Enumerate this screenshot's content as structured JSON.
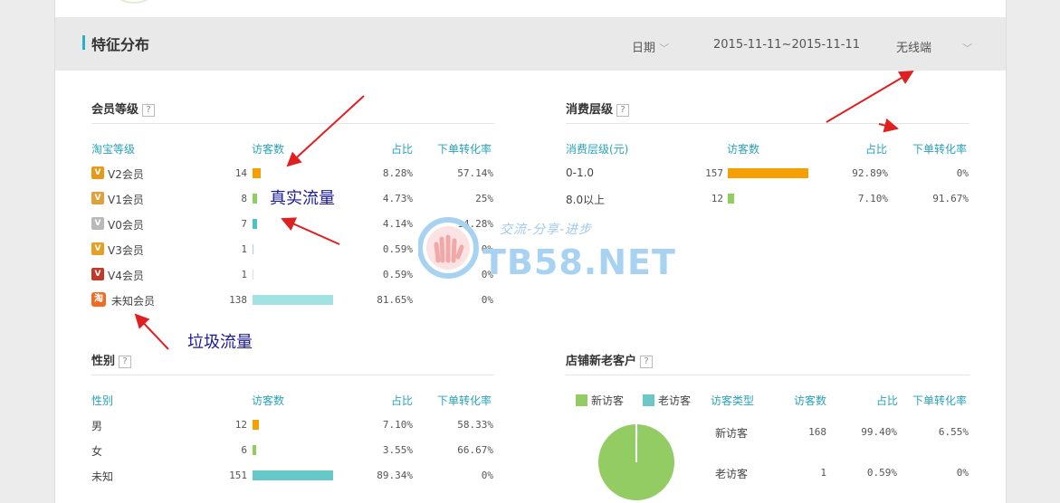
{
  "header": {
    "title": "特征分布",
    "period_label": "日期",
    "date_range": "2015-11-11~2015-11-11",
    "device_label": "无线端"
  },
  "member_level": {
    "title": "会员等级",
    "columns": [
      "淘宝等级",
      "访客数",
      "占比",
      "下单转化率"
    ],
    "rows": [
      {
        "name": "V2会员",
        "visitors": "14",
        "share": "8.28%",
        "conversion": "57.14%",
        "bar_pct": 8.28,
        "bar_color": "#f5a000",
        "icon": "v2-badge-icon"
      },
      {
        "name": "V1会员",
        "visitors": "8",
        "share": "4.73%",
        "conversion": "25%",
        "bar_pct": 4.73,
        "bar_color": "#8fcf5d",
        "icon": "v1-badge-icon"
      },
      {
        "name": "V0会员",
        "visitors": "7",
        "share": "4.14%",
        "conversion": "14.28%",
        "bar_pct": 4.14,
        "bar_color": "#4cc3c3",
        "icon": "v0-badge-icon"
      },
      {
        "name": "V3会员",
        "visitors": "1",
        "share": "0.59%",
        "conversion": "0%",
        "bar_pct": 0.59,
        "bar_color": "#9ed3e8",
        "icon": "v3-badge-icon"
      },
      {
        "name": "V4会员",
        "visitors": "1",
        "share": "0.59%",
        "conversion": "0%",
        "bar_pct": 0.59,
        "bar_color": "#c6e3ee",
        "icon": "v4-badge-icon"
      },
      {
        "name": "未知会员",
        "visitors": "138",
        "share": "81.65%",
        "conversion": "0%",
        "bar_pct": 81.65,
        "bar_color": "#a3e2e2",
        "icon": "taobao-icon"
      }
    ],
    "taobao_glyph": "淘"
  },
  "consumption": {
    "title": "消费层级",
    "columns": [
      "消费层级(元)",
      "访客数",
      "占比",
      "下单转化率"
    ],
    "rows": [
      {
        "name": "0-1.0",
        "visitors": "157",
        "share": "92.89%",
        "conversion": "0%",
        "bar_pct": 92.89,
        "bar_color": "#f5a000"
      },
      {
        "name": "8.0以上",
        "visitors": "12",
        "share": "7.10%",
        "conversion": "91.67%",
        "bar_pct": 7.1,
        "bar_color": "#8fcf5d"
      }
    ]
  },
  "gender": {
    "title": "性别",
    "columns": [
      "性别",
      "访客数",
      "占比",
      "下单转化率"
    ],
    "rows": [
      {
        "name": "男",
        "visitors": "12",
        "share": "7.10%",
        "conversion": "58.33%",
        "bar_pct": 7.1,
        "bar_color": "#f5a000"
      },
      {
        "name": "女",
        "visitors": "6",
        "share": "3.55%",
        "conversion": "66.67%",
        "bar_pct": 3.55,
        "bar_color": "#8fcf5d"
      },
      {
        "name": "未知",
        "visitors": "151",
        "share": "89.34%",
        "conversion": "0%",
        "bar_pct": 89.34,
        "bar_color": "#66c8c8"
      }
    ]
  },
  "new_old": {
    "title": "店铺新老客户",
    "legend": [
      {
        "label": "新访客",
        "color": "#94cc64"
      },
      {
        "label": "老访客",
        "color": "#6cc7c9"
      }
    ],
    "columns": [
      "访客类型",
      "访客数",
      "占比",
      "下单转化率"
    ],
    "rows": [
      {
        "name": "新访客",
        "visitors": "168",
        "share": "99.40%",
        "conversion": "6.55%"
      },
      {
        "name": "老访客",
        "visitors": "1",
        "share": "0.59%",
        "conversion": "0%"
      }
    ],
    "pie_new_share": 99.4
  },
  "annotations": {
    "real_traffic": "真实流量",
    "junk_traffic": "垃圾流量"
  },
  "watermark": {
    "tagline": "交流-分享-进步",
    "site": "TB58.NET"
  },
  "help_glyph": "?",
  "chevron_glyph": "﹀"
}
